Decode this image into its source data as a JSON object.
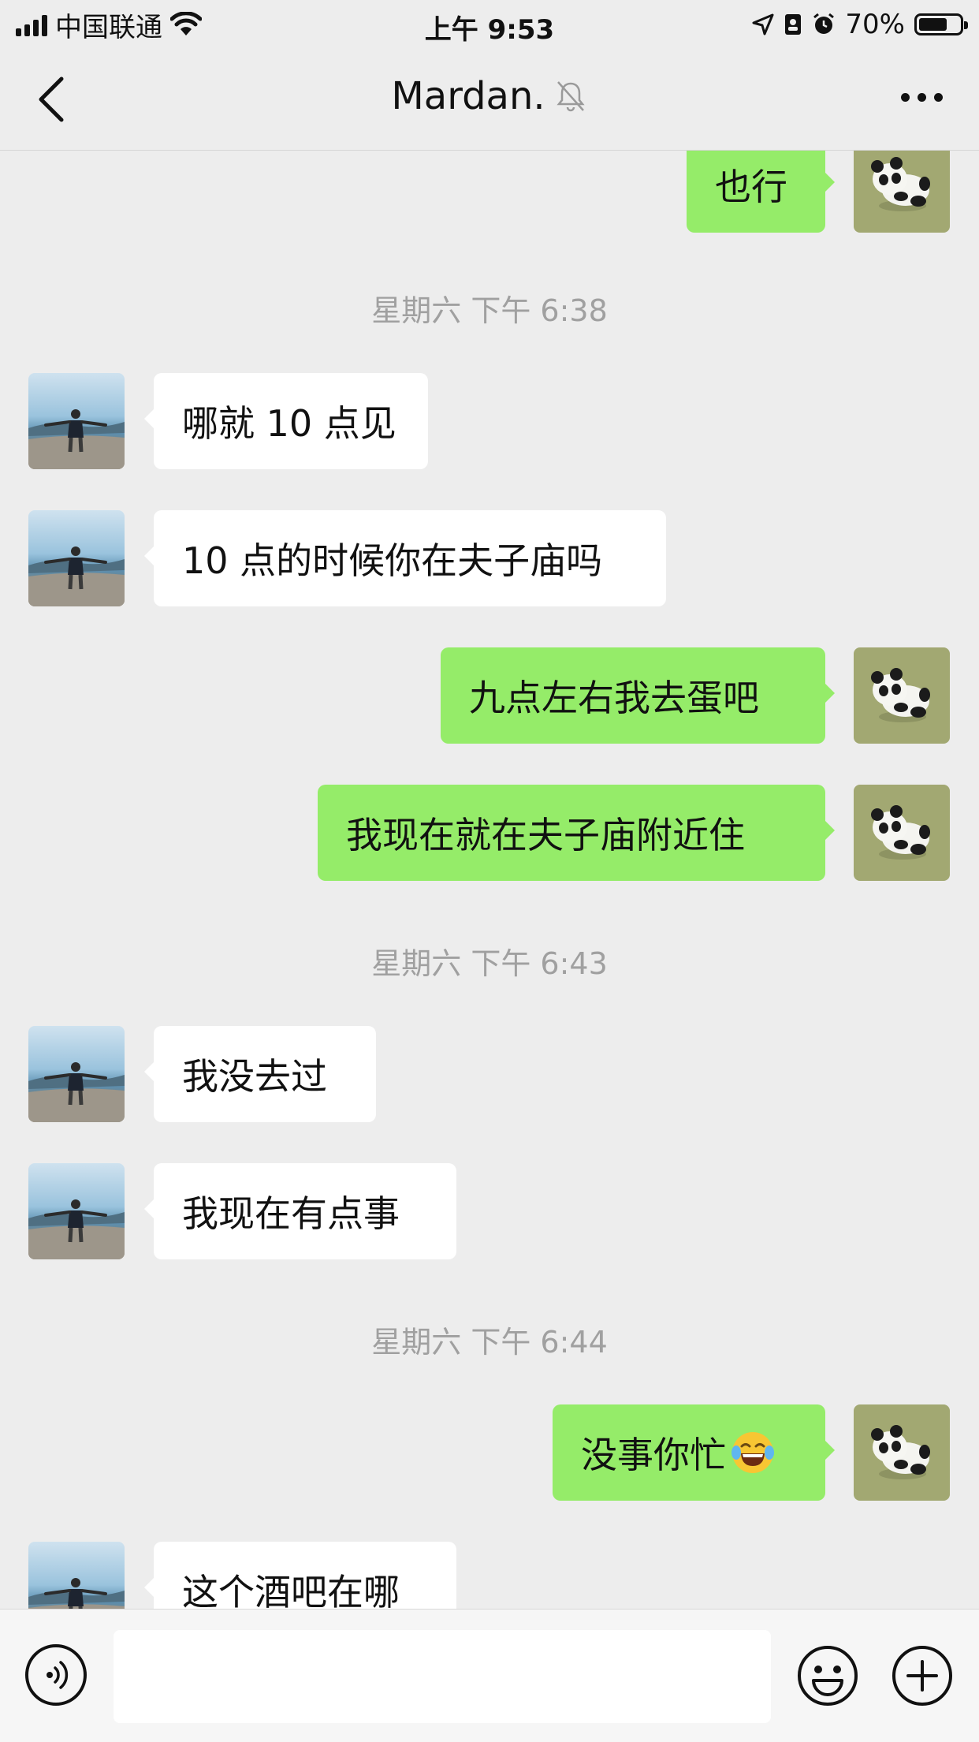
{
  "status_bar": {
    "carrier": "中国联通",
    "time": "上午 9:53",
    "battery": "70%",
    "battery_level": 0.7
  },
  "nav": {
    "title": "Mardan."
  },
  "colors": {
    "my_bubble": "#95ec69",
    "their_bubble": "#ffffff",
    "background": "#ededed",
    "timestamp": "#a0a0a0"
  },
  "messages": [
    {
      "sender": "me",
      "text": "也行"
    },
    {
      "type": "timestamp",
      "text": "星期六 下午 6:38"
    },
    {
      "sender": "them",
      "text": "哪就 10 点见"
    },
    {
      "sender": "them",
      "text": "10 点的时候你在夫子庙吗"
    },
    {
      "sender": "me",
      "text": "九点左右我去蛋吧"
    },
    {
      "sender": "me",
      "text": "我现在就在夫子庙附近住"
    },
    {
      "type": "timestamp",
      "text": "星期六 下午 6:43"
    },
    {
      "sender": "them",
      "text": "我没去过"
    },
    {
      "sender": "them",
      "text": "我现在有点事"
    },
    {
      "type": "timestamp",
      "text": "星期六 下午 6:44"
    },
    {
      "sender": "me",
      "text": "没事你忙",
      "emoji": "tears-of-joy"
    },
    {
      "sender": "them",
      "text": "这个酒吧在哪"
    }
  ],
  "input": {
    "placeholder": ""
  },
  "icons": {
    "back": "chevron-left-icon",
    "mute": "bell-off-icon",
    "more": "more-dots-icon",
    "voice": "voice-icon",
    "emoji": "smiley-icon",
    "plus": "plus-icon"
  }
}
